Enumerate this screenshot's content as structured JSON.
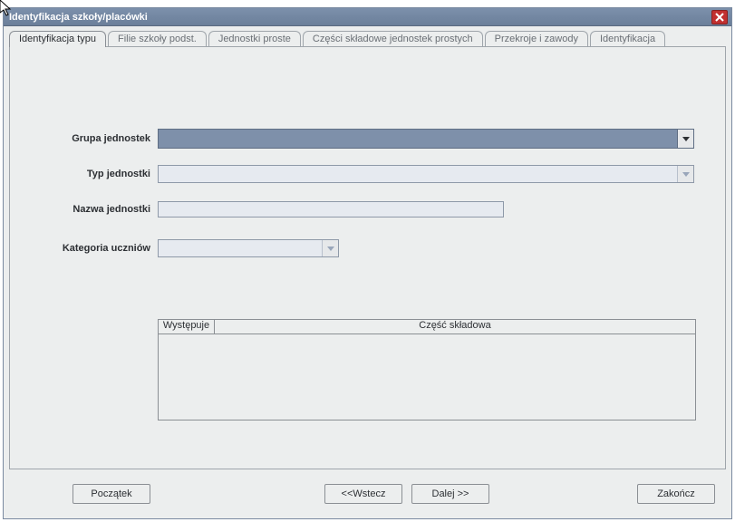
{
  "window": {
    "title": "Identyfikacja szkoły/placówki"
  },
  "tabs": [
    {
      "label": "Identyfikacja typu",
      "active": true
    },
    {
      "label": "Filie szkoły podst.",
      "active": false
    },
    {
      "label": "Jednostki proste",
      "active": false
    },
    {
      "label": "Części składowe jednostek prostych",
      "active": false
    },
    {
      "label": "Przekroje i zawody",
      "active": false
    },
    {
      "label": "Identyfikacja",
      "active": false
    }
  ],
  "form": {
    "grupa_jednostek": {
      "label": "Grupa jednostek",
      "value": ""
    },
    "typ_jednostki": {
      "label": "Typ jednostki",
      "value": ""
    },
    "nazwa_jednostki": {
      "label": "Nazwa jednostki",
      "value": ""
    },
    "kategoria_uczniow": {
      "label": "Kategoria uczniów",
      "value": ""
    }
  },
  "table": {
    "col1": "Występuje",
    "col2": "Część składowa"
  },
  "wizard": {
    "start": "Początek",
    "back": "<<Wstecz",
    "next": "Dalej >>",
    "finish": "Zakończ"
  }
}
